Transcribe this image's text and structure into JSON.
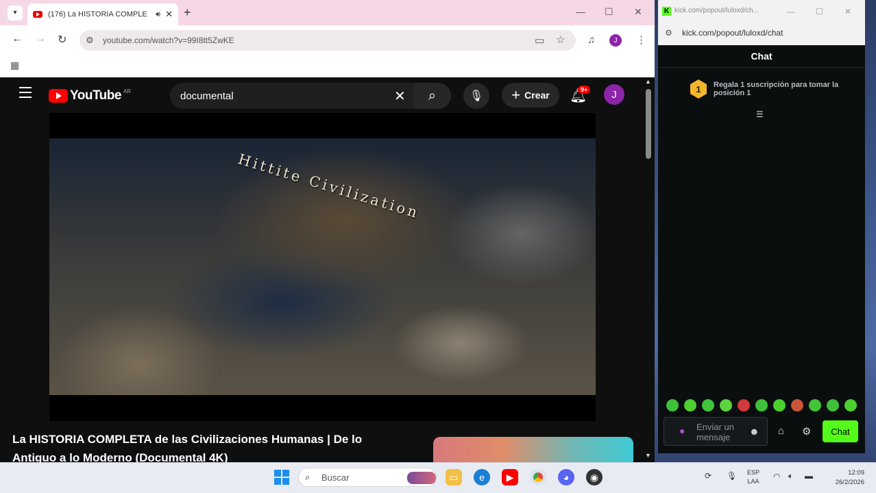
{
  "browser": {
    "tab_title": "(176) La HISTORIA COMPLE",
    "url": "youtube.com/watch?v=99I8tt5ZwKE",
    "profile_initial": "J"
  },
  "youtube": {
    "logo_text": "YouTube",
    "country_code": "AR",
    "search_query": "documental",
    "create_label": "Crear",
    "notification_badge": "9+",
    "avatar_initial": "J",
    "video_overlay_text": "Hittite Civilization",
    "video_title": "La HISTORIA COMPLETA de las Civilizaciones Humanas | De lo Antiguo a lo Moderno (Documental 4K)"
  },
  "kick": {
    "tab_title": "kick.com/popout/luloxd/ch...",
    "url": "kick.com/popout/luloxd/chat",
    "header": "Chat",
    "gift_rank": "1",
    "gift_text": "Regala 1 suscripción para tomar la posición 1",
    "input_placeholder": "Enviar un mensaje",
    "chat_button": "Chat",
    "emote_count": 11
  },
  "taskbar": {
    "search_placeholder": "Buscar",
    "lang_top": "ESP",
    "lang_bottom": "LAA",
    "time": "12:09",
    "date": "26/2/2026"
  },
  "colors": {
    "youtube_red": "#ff0000",
    "kick_green": "#53fc18",
    "tab_strip": "#f6d7e6",
    "profile_purple": "#8e24aa"
  }
}
